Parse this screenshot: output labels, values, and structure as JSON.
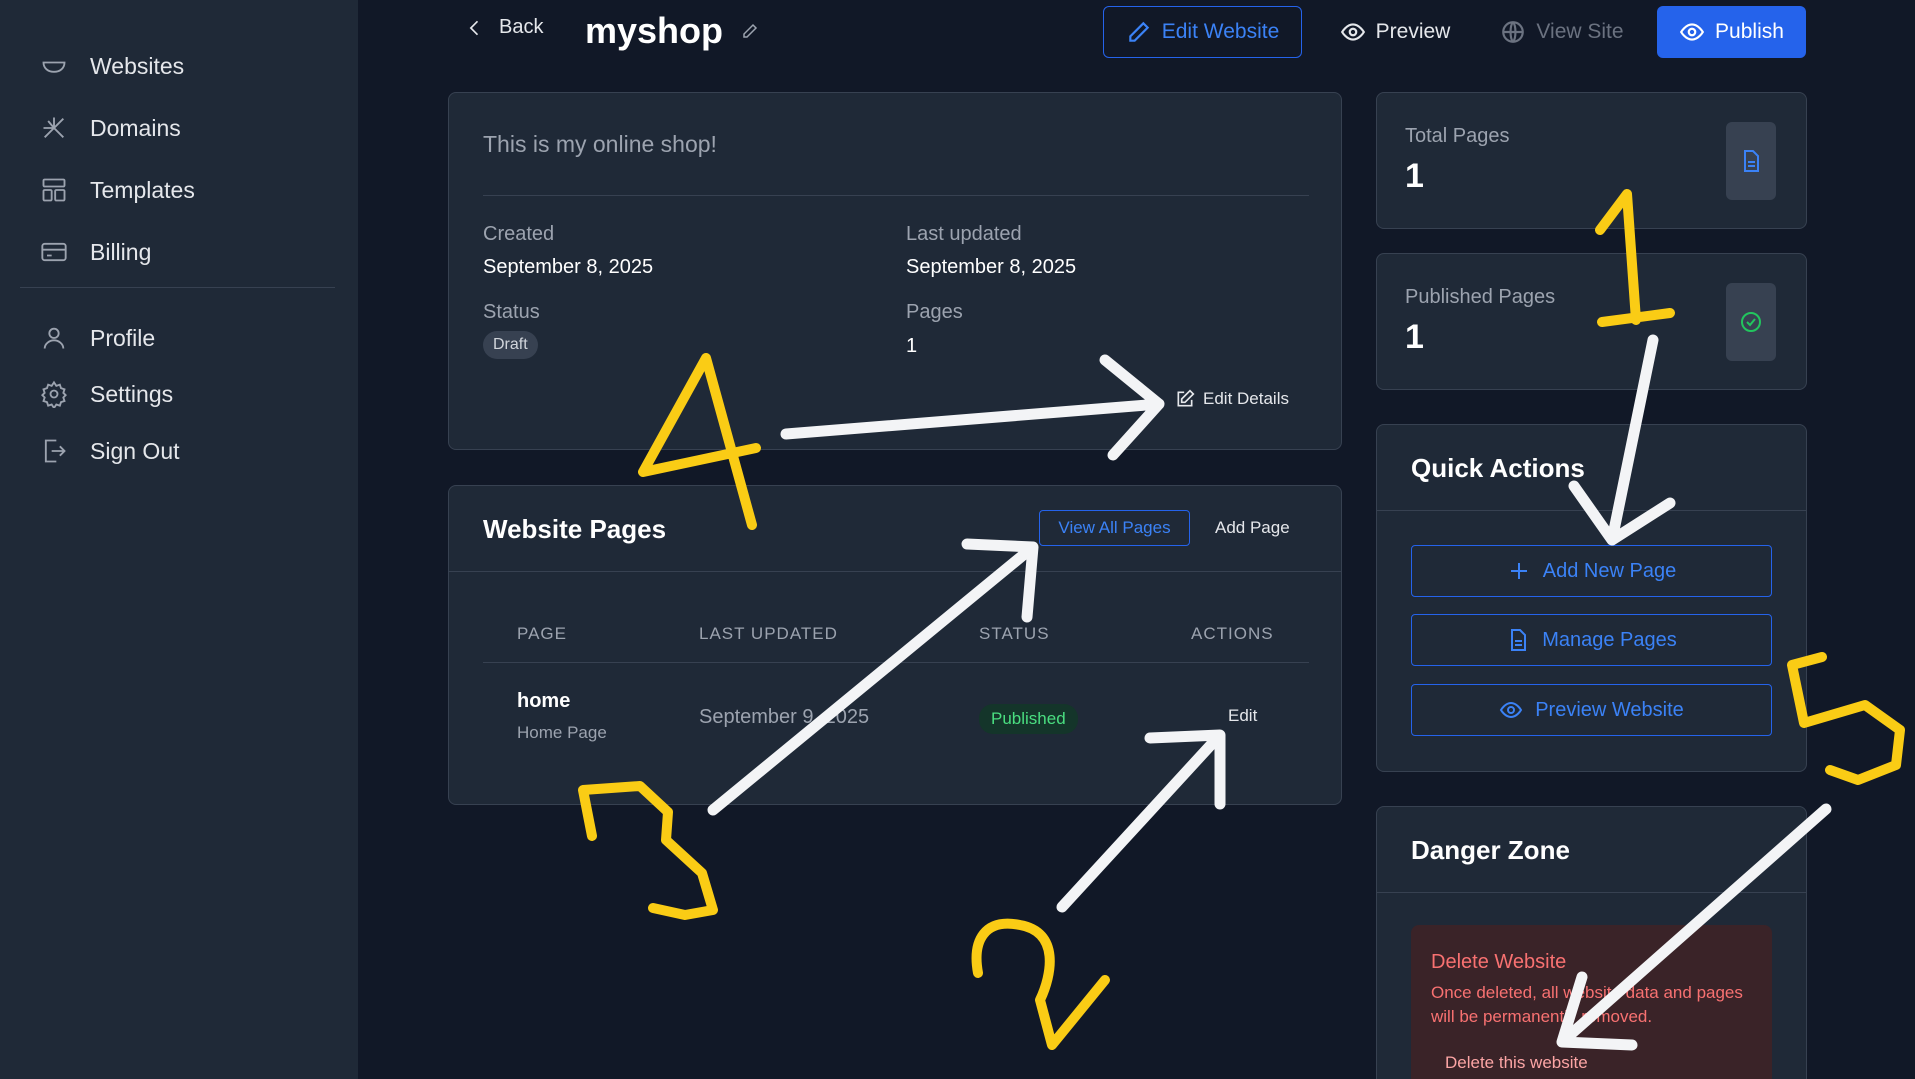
{
  "sidebar": {
    "items": [
      {
        "label": "Websites",
        "icon": "websites-icon"
      },
      {
        "label": "Domains",
        "icon": "domains-icon"
      },
      {
        "label": "Templates",
        "icon": "templates-icon"
      },
      {
        "label": "Billing",
        "icon": "billing-icon"
      },
      {
        "label": "Profile",
        "icon": "user-icon"
      },
      {
        "label": "Settings",
        "icon": "gear-icon"
      },
      {
        "label": "Sign Out",
        "icon": "sign-out-icon"
      }
    ]
  },
  "topbar": {
    "back_label": "Back",
    "site_name": "myshop",
    "edit_website_label": "Edit Website",
    "preview_label": "Preview",
    "view_site_label": "View Site",
    "publish_label": "Publish"
  },
  "info": {
    "description": "This is my online shop!",
    "created_label": "Created",
    "created_value": "September 8, 2025",
    "updated_label": "Last updated",
    "updated_value": "September 8, 2025",
    "status_label": "Status",
    "status_value": "Draft",
    "pages_label": "Pages",
    "pages_value": "1",
    "edit_details_label": "Edit Details"
  },
  "pages": {
    "title": "Website Pages",
    "view_all_label": "View All Pages",
    "add_page_label": "Add Page",
    "columns": [
      "PAGE",
      "LAST UPDATED",
      "STATUS",
      "ACTIONS"
    ],
    "rows": [
      {
        "name": "home",
        "subtitle": "Home Page",
        "updated": "September 9, 2025",
        "status": "Published",
        "action": "Edit"
      }
    ]
  },
  "stats": {
    "total_pages_label": "Total Pages",
    "total_pages_value": "1",
    "published_pages_label": "Published Pages",
    "published_pages_value": "1"
  },
  "quick_actions": {
    "title": "Quick Actions",
    "add_new_page": "Add New Page",
    "manage_pages": "Manage Pages",
    "preview_website": "Preview Website"
  },
  "danger_zone": {
    "title": "Danger Zone",
    "delete_title": "Delete Website",
    "delete_text": "Once deleted, all website data and pages will be permanently removed.",
    "delete_button": "Delete this website"
  },
  "annotations": {
    "colors": {
      "arrow": "#f3f4f6",
      "number": "#facc15"
    },
    "labels": [
      "1",
      "2",
      "3",
      "4",
      "5"
    ]
  },
  "colors": {
    "background": "#111827",
    "sidebar": "#1f2937",
    "accent": "#2563eb",
    "success": "#4ade80",
    "danger": "#f87171"
  }
}
